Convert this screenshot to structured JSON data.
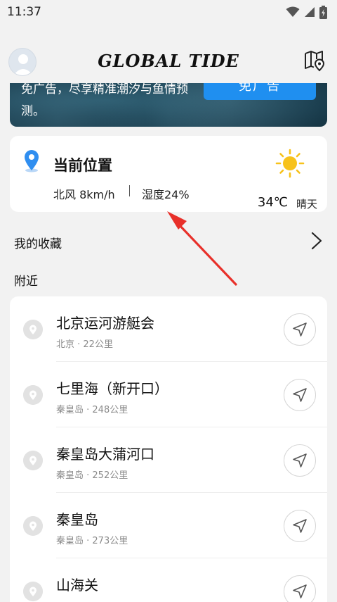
{
  "status_bar": {
    "time": "11:37"
  },
  "header": {
    "title": "GLOBAL TIDE"
  },
  "banner": {
    "text": "免广告，尽享精准潮汐与鱼情预测。",
    "button_label": "免广告"
  },
  "location": {
    "title": "当前位置",
    "wind": "北风 8km/h",
    "humidity": "湿度24%",
    "temperature": "34℃",
    "weather": "晴天"
  },
  "favorites": {
    "label": "我的收藏"
  },
  "nearby": {
    "label": "附近",
    "items": [
      {
        "name": "北京运河游艇会",
        "sub": "北京 · 22公里"
      },
      {
        "name": "七里海（新开口）",
        "sub": "秦皇岛 · 248公里"
      },
      {
        "name": "秦皇岛大蒲河口",
        "sub": "秦皇岛 · 252公里"
      },
      {
        "name": "秦皇岛",
        "sub": "秦皇岛 · 273公里"
      },
      {
        "name": "山海关",
        "sub": ""
      }
    ]
  },
  "colors": {
    "accent": "#1f8ff0",
    "annotation_arrow": "#e8302a",
    "sun": "#f7c21b"
  }
}
